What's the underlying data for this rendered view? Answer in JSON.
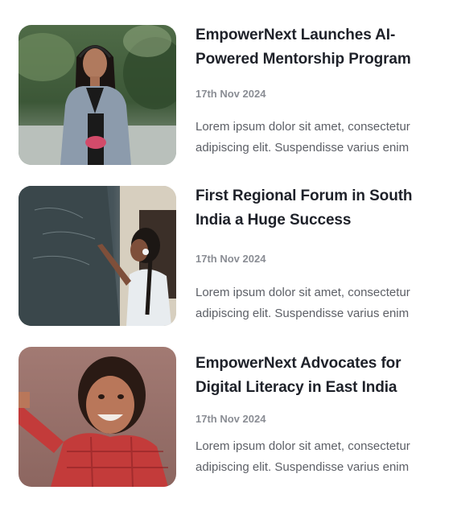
{
  "news": {
    "items": [
      {
        "title": "EmpowerNext Launches AI-Powered Mentorship Program",
        "date": "17th Nov 2024",
        "excerpt": "Lorem ipsum dolor sit amet, consectetur adipiscing elit. Suspendisse varius enim",
        "image": "young-woman-with-headphones-photo"
      },
      {
        "title": "First Regional Forum in South India a Huge Success",
        "date": "17th Nov 2024",
        "excerpt": "Lorem ipsum dolor sit amet, consectetur adipiscing elit. Suspendisse varius enim",
        "image": "girl-writing-on-chalkboard-photo"
      },
      {
        "title": "EmpowerNext Advocates for Digital Literacy in East India",
        "date": "17th Nov 2024",
        "excerpt": "Lorem ipsum dolor sit amet, consectetur adipiscing elit. Suspendisse varius enim",
        "image": "smiling-child-photo"
      }
    ]
  },
  "colors": {
    "title": "#1e2129",
    "date": "#8a8d94",
    "excerpt": "#5c5f66",
    "background": "#ffffff"
  }
}
